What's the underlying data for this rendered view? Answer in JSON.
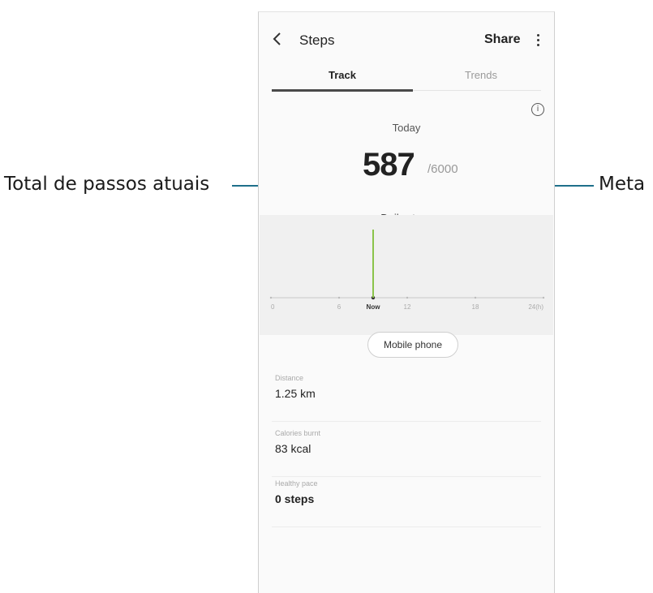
{
  "callouts": {
    "left_label": "Total de passos atuais",
    "right_label": "Meta"
  },
  "appbar": {
    "title": "Steps",
    "share": "Share"
  },
  "tabs": [
    {
      "label": "Track",
      "selected": true
    },
    {
      "label": "Trends",
      "selected": false
    }
  ],
  "summary": {
    "period": "Today",
    "steps": "587",
    "goal": "/6000",
    "caption": "Daily steps"
  },
  "chart_data": {
    "type": "bar",
    "x_ticks": [
      "0",
      "6",
      "Now",
      "12",
      "18",
      "24(h)"
    ],
    "now_hour": 9,
    "values": [
      {
        "hour": 9,
        "relative_height": 1.0
      }
    ],
    "bar_color": "#8bc34a"
  },
  "source_button": "Mobile phone",
  "stats": [
    {
      "label": "Distance",
      "value": "1.25 km"
    },
    {
      "label": "Calories burnt",
      "value": "83 kcal"
    },
    {
      "label": "Healthy pace",
      "value": "0 steps"
    }
  ],
  "colors": {
    "callout_line": "#1e6f8a",
    "bar": "#8bc34a"
  }
}
